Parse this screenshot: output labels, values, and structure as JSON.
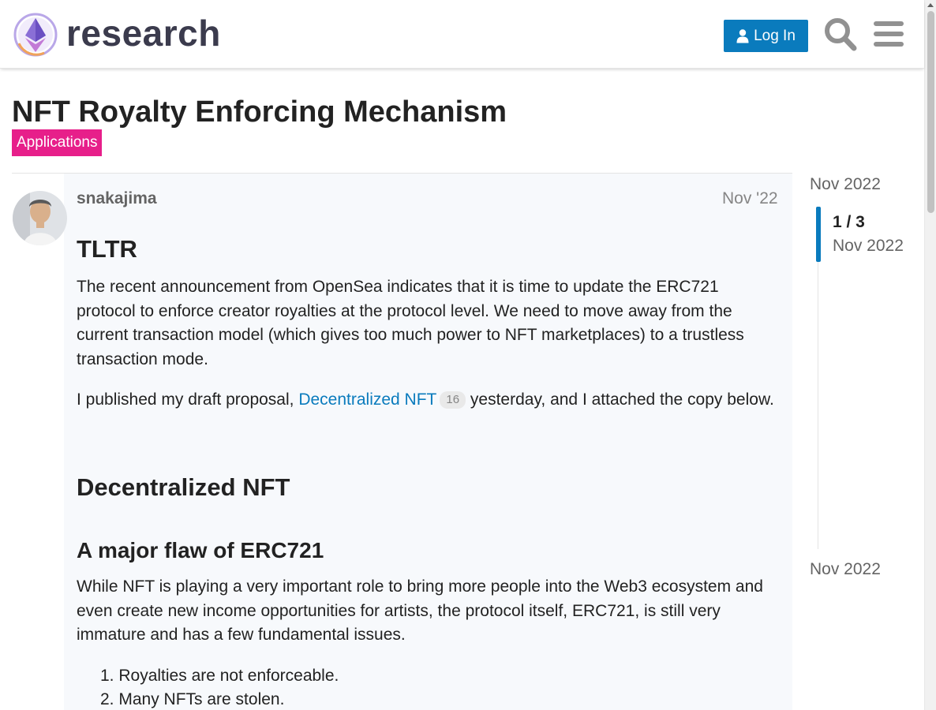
{
  "header": {
    "logo_text": "research",
    "login_label": "Log In",
    "icons": {
      "user": "user-icon",
      "search": "search-icon",
      "menu": "hamburger-icon"
    }
  },
  "topic": {
    "title": "NFT Royalty Enforcing Mechanism",
    "category": "Applications",
    "category_color": "#e71f8a"
  },
  "post": {
    "username": "snakajima",
    "date": "Nov '22",
    "heading1": "TLTR",
    "para1": "The recent announcement from OpenSea indicates that it is time to update the ERC721 protocol to enforce creator royalties at the protocol level. We need to move away from the current transaction model (which gives too much power to NFT marketplaces) to a trustless transaction mode.",
    "para2_before": "I published my draft proposal,",
    "para2_link": "Decentralized NFT",
    "para2_clicks": "16",
    "para2_after": "yesterday, and I attached the copy below.",
    "heading2": "Decentralized NFT",
    "heading3": "A major flaw of ERC721",
    "para3": "While NFT is playing a very important role to bring more people into the Web3 ecosystem and even create new income opportunities for artists, the protocol itself, ERC721, is still very immature and has a few fundamental issues.",
    "list": [
      "Royalties are not enforceable.",
      "Many NFTs are stolen."
    ]
  },
  "timeline": {
    "start": "Nov 2022",
    "position": "1 / 3",
    "position_date": "Nov 2022",
    "end": "Nov 2022"
  },
  "colors": {
    "accent": "#0a7bbd",
    "category": "#e71f8a",
    "post_bg": "#f7f9fc"
  }
}
